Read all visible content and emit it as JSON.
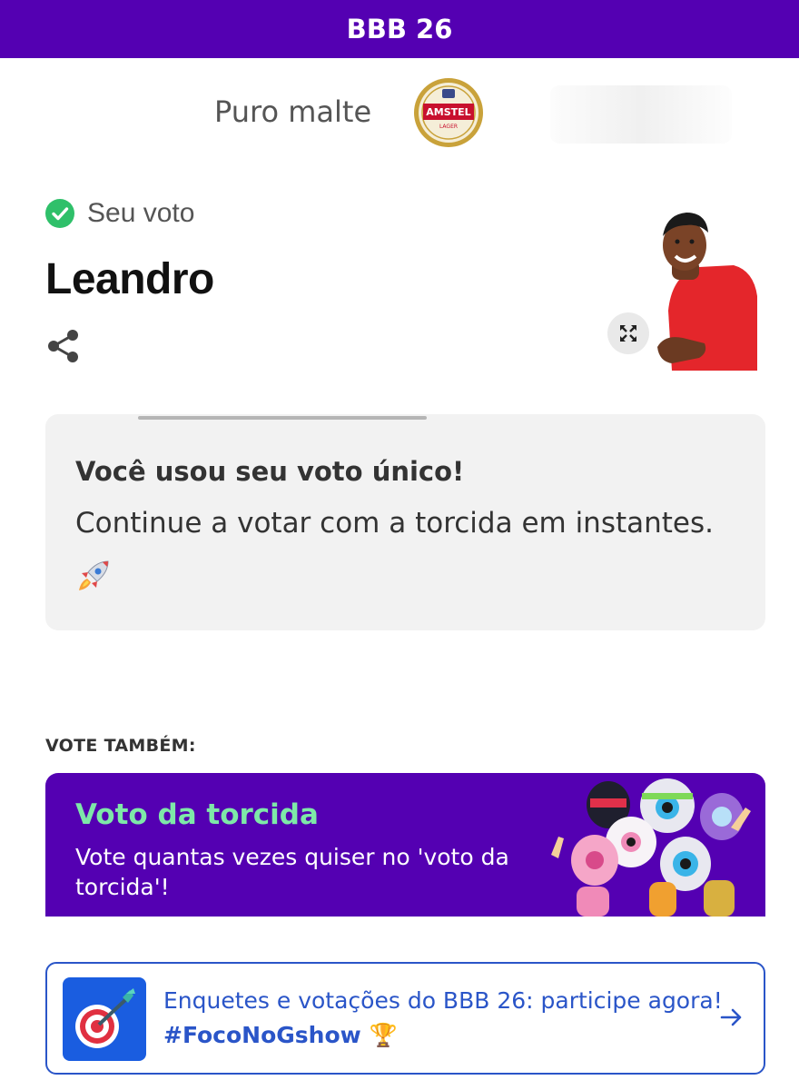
{
  "header": {
    "title": "BBB 26"
  },
  "sponsor": {
    "tagline": "Puro malte",
    "logo_text": "AMSTEL",
    "logo_subtext": "LAGER"
  },
  "vote": {
    "status_label": "Seu voto",
    "candidate_name": "Leandro"
  },
  "info_card": {
    "title": "Você usou seu voto único!",
    "text": "Continue a votar com a torcida em instantes."
  },
  "vote_also": {
    "label": "VOTE TAMBÉM:"
  },
  "promo": {
    "title": "Voto da torcida",
    "text": "Vote quantas vezes quiser no 'voto da torcida'!"
  },
  "banner": {
    "text": "Enquetes e votações do BBB 26: participe agora!",
    "hashtag": "#FocoNoGshow 🏆"
  },
  "colors": {
    "brand_purple": "#5400b2",
    "accent_green": "#7ee8a8",
    "check_green": "#2fc06a",
    "link_blue": "#2a55c8"
  },
  "icons": [
    "check-circle-icon",
    "share-icon",
    "expand-icon",
    "rocket-icon",
    "target-icon",
    "arrow-right-icon"
  ]
}
